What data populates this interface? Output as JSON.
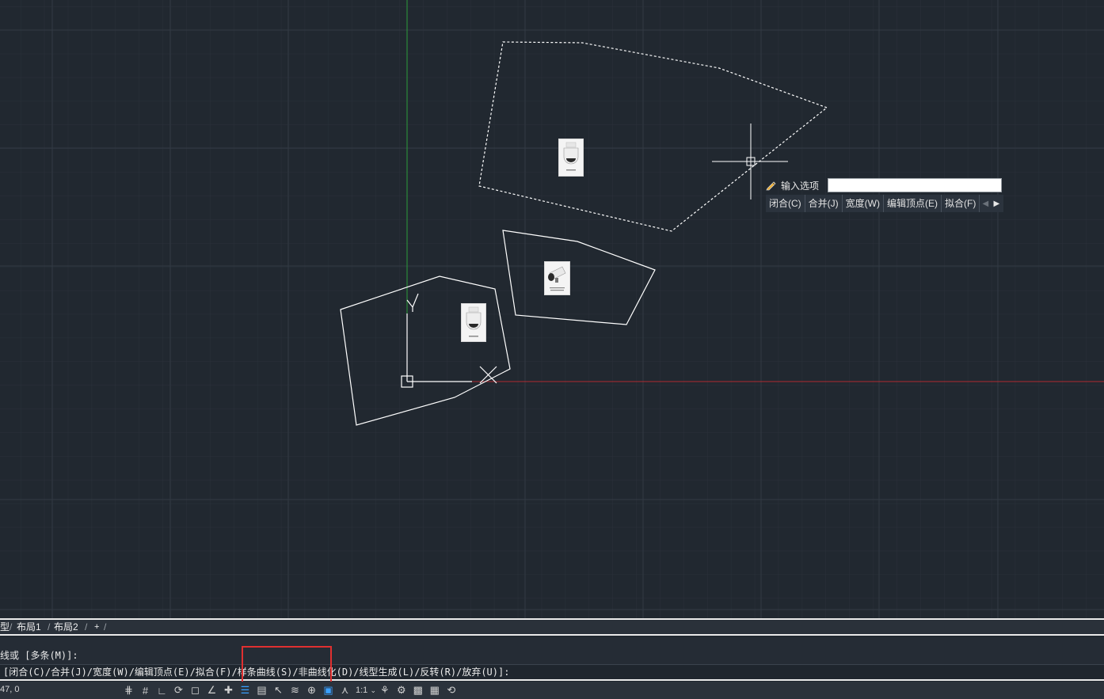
{
  "dynamic_input": {
    "prompt_label": "输入选项",
    "input_value": "",
    "options": [
      "闭合(C)",
      "合并(J)",
      "宽度(W)",
      "编辑顶点(E)",
      "拟合(F)"
    ]
  },
  "layout_tabs": {
    "model_tab": "型",
    "tabs": [
      "布局1",
      "布局2"
    ],
    "add_tab": "+"
  },
  "command": {
    "history_line": "线或 [多条(M)]:",
    "prompt_line": "[闭合(C)/合并(J)/宽度(W)/编辑顶点(E)/拟合(F)/样条曲线(S)/非曲线化(D)/线型生成(L)/反转(R)/放弃(U)]:"
  },
  "status_bar": {
    "coords": "47, 0",
    "scale": "1:1"
  },
  "ucs": {
    "y_label": "Y"
  },
  "icons": {
    "pencil": "pencil-icon",
    "nav_left": "chevron-left-icon",
    "nav_right": "chevron-right-icon"
  },
  "colors": {
    "canvas_bg": "#212830",
    "x_axis": "#b02a30",
    "y_axis": "#2a9c3a",
    "geometry": "#ffffff",
    "highlight": "#e03030"
  }
}
